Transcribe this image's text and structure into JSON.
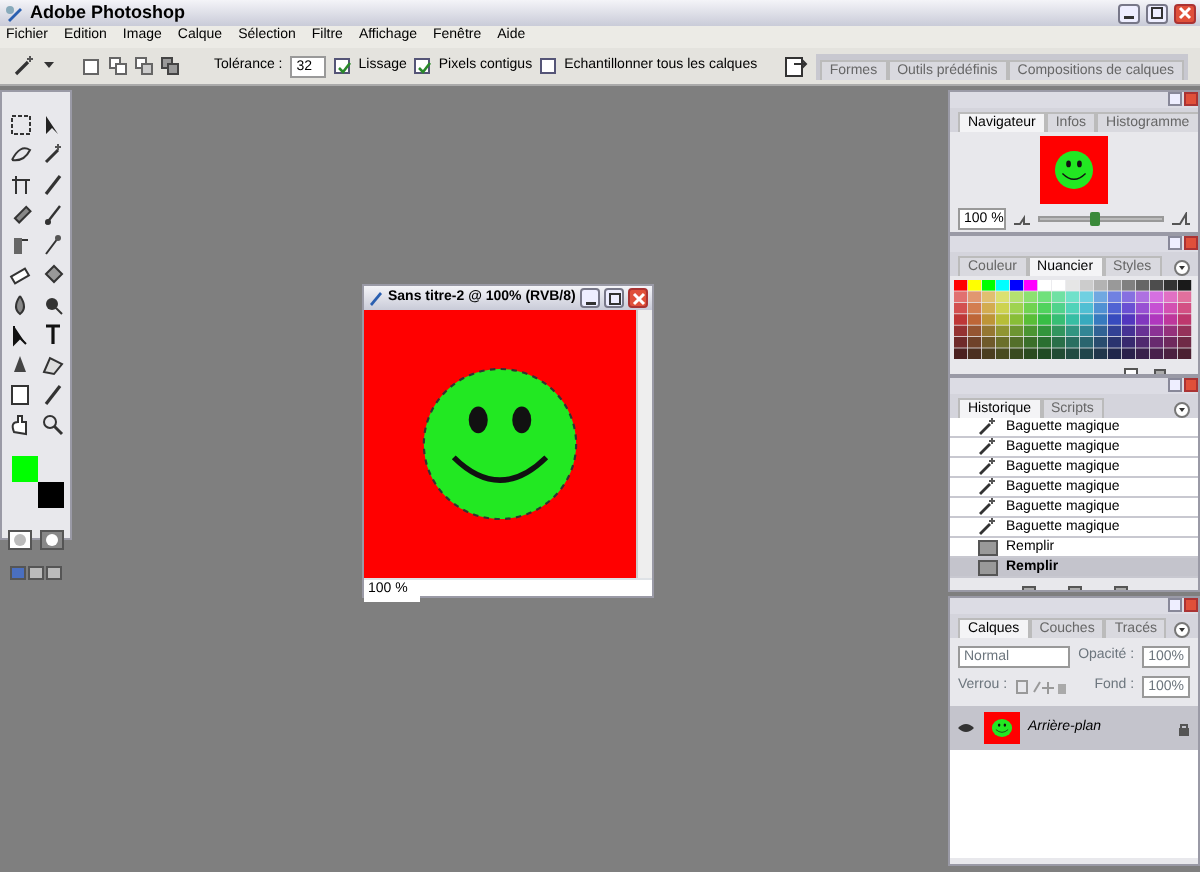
{
  "window": {
    "title": "Adobe Photoshop"
  },
  "menu": [
    "Fichier",
    "Edition",
    "Image",
    "Calque",
    "Sélection",
    "Filtre",
    "Affichage",
    "Fenêtre",
    "Aide"
  ],
  "options_bar": {
    "tolerance_label": "Tolérance :",
    "tolerance": "32",
    "checkboxes": [
      {
        "label": "Lissage",
        "checked": true
      },
      {
        "label": "Pixels contigus",
        "checked": true
      },
      {
        "label": "Echantillonner tous les calques",
        "checked": false
      }
    ],
    "palette_tabs": [
      "Formes",
      "Outils prédéfinis",
      "Compositions de calques"
    ]
  },
  "toolbox": {
    "color_swatches": [
      {
        "kind": "foreground",
        "color": "#00ff00"
      },
      {
        "kind": "background",
        "color": "#000000"
      }
    ]
  },
  "document": {
    "title": "Sans titre-2 @ 100% (RVB/8)",
    "zoom": "100 %"
  },
  "navigator": {
    "tabs": [
      {
        "label": "Navigateur",
        "selected": true
      },
      {
        "label": "Infos",
        "selected": false
      },
      {
        "label": "Histogramme",
        "selected": false
      }
    ],
    "zoom": "100 %",
    "level": 0.45
  },
  "swatches": {
    "tabs": [
      {
        "label": "Couleur",
        "selected": false
      },
      {
        "label": "Nuancier",
        "selected": true
      },
      {
        "label": "Styles",
        "selected": false
      }
    ]
  },
  "history": {
    "tabs": [
      {
        "label": "Historique",
        "selected": true
      },
      {
        "label": "Scripts",
        "selected": false
      }
    ],
    "items": [
      {
        "label": "Baguette magique",
        "kind": "wand",
        "selected": false
      },
      {
        "label": "Baguette magique",
        "kind": "wand",
        "selected": false
      },
      {
        "label": "Baguette magique",
        "kind": "wand",
        "selected": false
      },
      {
        "label": "Baguette magique",
        "kind": "wand",
        "selected": false
      },
      {
        "label": "Baguette magique",
        "kind": "wand",
        "selected": false
      },
      {
        "label": "Baguette magique",
        "kind": "wand",
        "selected": false
      },
      {
        "label": "Remplir",
        "kind": "fill",
        "selected": false
      },
      {
        "label": "Remplir",
        "kind": "fill",
        "selected": true
      }
    ]
  },
  "layers": {
    "tabs": [
      {
        "label": "Calques",
        "selected": true
      },
      {
        "label": "Couches",
        "selected": false
      },
      {
        "label": "Tracés",
        "selected": false
      }
    ],
    "blend_mode": "Normal",
    "opacity_label": "Opacité :",
    "opacity": "100%",
    "lock_label": "Verrou :",
    "fill_label": "Fond :",
    "fill": "100%",
    "items": [
      {
        "name": "Arrière-plan",
        "visible": true,
        "selected": true
      }
    ]
  }
}
